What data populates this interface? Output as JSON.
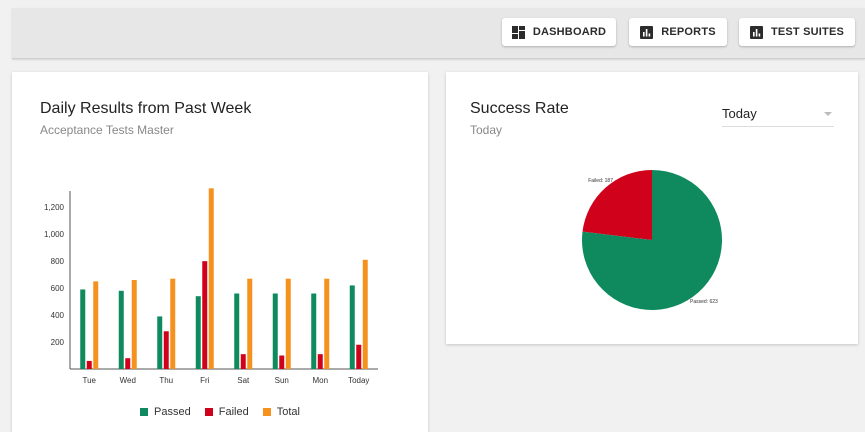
{
  "nav": {
    "buttons": [
      {
        "label": "DASHBOARD",
        "icon": "dashboard-icon"
      },
      {
        "label": "REPORTS",
        "icon": "bar-chart-icon"
      },
      {
        "label": "TEST SUITES",
        "icon": "bar-chart-icon"
      }
    ]
  },
  "colors": {
    "passed": "#0f8a5f",
    "failed": "#d0021b",
    "total": "#f5921e"
  },
  "daily": {
    "title": "Daily Results from Past Week",
    "subtitle": "Acceptance Tests Master"
  },
  "success": {
    "title": "Success Rate",
    "subtitle": "Today",
    "period_select": {
      "value": "Today"
    }
  },
  "chart_data": [
    {
      "type": "bar",
      "categories": [
        "Tue",
        "Wed",
        "Thu",
        "Fri",
        "Sat",
        "Sun",
        "Mon",
        "Today"
      ],
      "series": [
        {
          "name": "Passed",
          "values": [
            590,
            580,
            390,
            540,
            560,
            560,
            560,
            620
          ]
        },
        {
          "name": "Failed",
          "values": [
            60,
            80,
            280,
            800,
            110,
            100,
            110,
            180
          ]
        },
        {
          "name": "Total",
          "values": [
            650,
            660,
            670,
            1340,
            670,
            670,
            670,
            810
          ]
        }
      ],
      "yticks": [
        200,
        400,
        600,
        800,
        1000,
        1200
      ],
      "ytick_labels": [
        "200",
        "400",
        "600",
        "800",
        "1,000",
        "1,200"
      ],
      "ylim": [
        0,
        1350
      ],
      "grid": false,
      "legend": "bottom"
    },
    {
      "type": "pie",
      "slices": [
        {
          "label": "Failed: 187",
          "value": 187
        },
        {
          "label": "Passed: 623",
          "value": 623
        }
      ]
    }
  ]
}
